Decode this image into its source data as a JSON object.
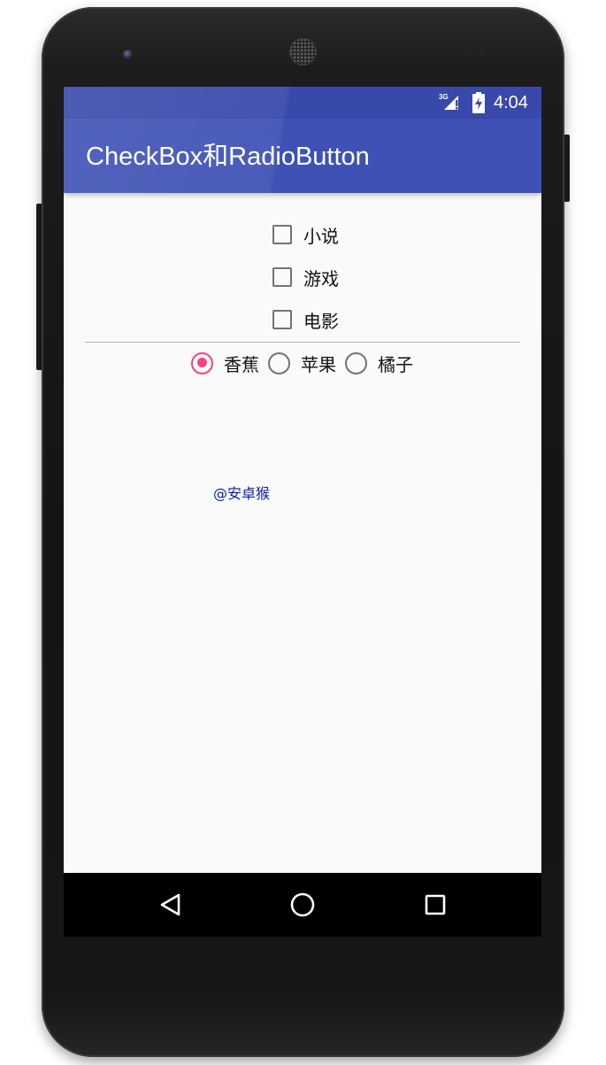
{
  "status_bar": {
    "network_label": "3G",
    "time": "4:04"
  },
  "app_bar": {
    "title": "CheckBox和RadioButton"
  },
  "checkboxes": [
    {
      "label": "小说",
      "checked": false
    },
    {
      "label": "游戏",
      "checked": false
    },
    {
      "label": "电影",
      "checked": false
    }
  ],
  "radios": [
    {
      "label": "香蕉",
      "checked": true
    },
    {
      "label": "苹果",
      "checked": false
    },
    {
      "label": "橘子",
      "checked": false
    }
  ],
  "watermark": "@安卓猴",
  "colors": {
    "status_bar": "#3949ab",
    "app_bar": "#3f51b5",
    "accent": "#ff4081",
    "watermark": "#0b1bb5"
  },
  "icons": {
    "nav_back": "back-triangle-icon",
    "nav_home": "home-circle-icon",
    "nav_recents": "recents-square-icon"
  }
}
